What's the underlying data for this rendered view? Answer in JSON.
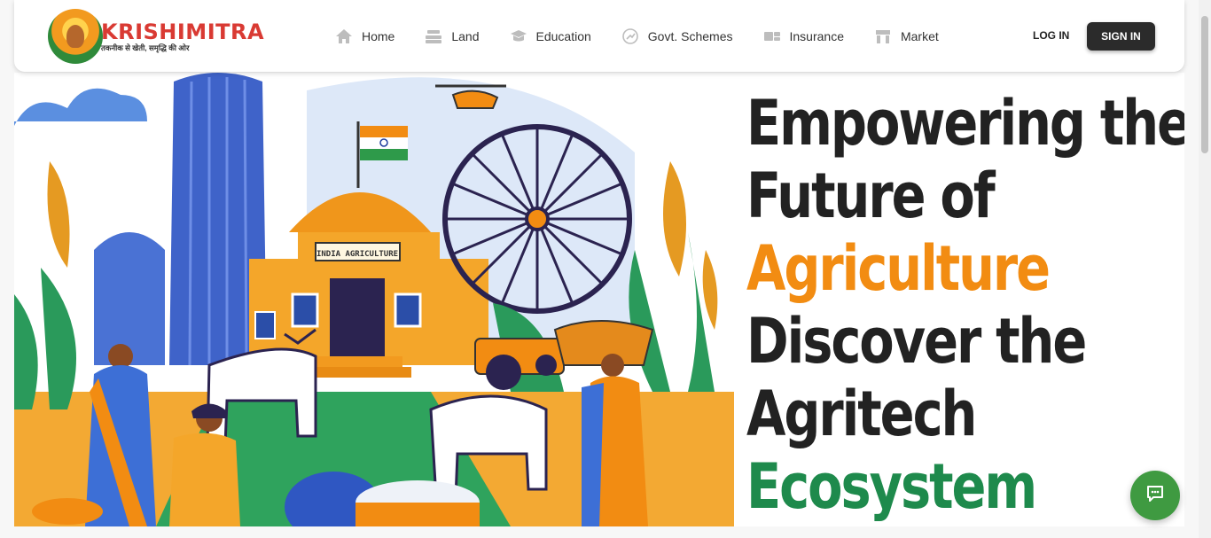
{
  "brand": {
    "name": "KRISHIMITRA",
    "tagline": "तकनीक से खेती, समृद्धि की ओर"
  },
  "nav": {
    "items": [
      {
        "label": "Home",
        "icon": "home-icon"
      },
      {
        "label": "Land",
        "icon": "land-icon"
      },
      {
        "label": "Education",
        "icon": "graduation-cap-icon"
      },
      {
        "label": "Govt. Schemes",
        "icon": "schemes-icon"
      },
      {
        "label": "Insurance",
        "icon": "insurance-icon"
      },
      {
        "label": "Market",
        "icon": "market-icon"
      }
    ]
  },
  "auth": {
    "login_label": "LOG IN",
    "signin_label": "SIGN IN"
  },
  "hero": {
    "line1": "Empowering the",
    "line2": "Future of",
    "line3": "Agriculture",
    "line4": "Discover the",
    "line5": "Agritech",
    "line6": "Ecosystem",
    "building_sign": "INDIA AGRICULTURE",
    "colors": {
      "highlight_orange": "#f28c12",
      "highlight_green": "#1e8a4c"
    }
  },
  "chat": {
    "icon": "chat-icon",
    "color": "#3f9a41"
  }
}
